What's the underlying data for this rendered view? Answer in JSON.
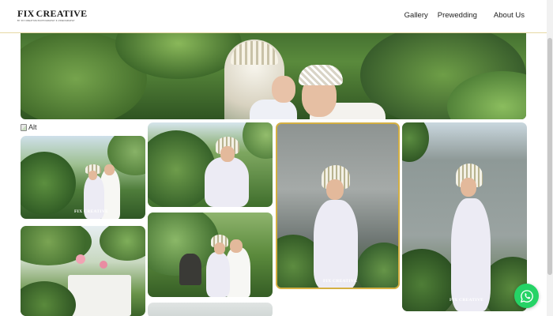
{
  "brand": {
    "logo_left": "FIX",
    "logo_right": "CREATIVE",
    "tagline": "BY FIX CREATIVE PHOTOGRAPHY & VIDEOGRAPHY"
  },
  "nav": {
    "items": [
      {
        "label": "Gallery"
      },
      {
        "label": "Prewedding"
      },
      {
        "label": "About Us"
      }
    ]
  },
  "gallery": {
    "broken_image_alt": "Alt",
    "watermark": "FIX CREATIVE"
  },
  "colors": {
    "accent_border": "#d4b043",
    "whatsapp": "#25d366",
    "header_divider": "#e6d9a4"
  },
  "icons": {
    "floating_button": "whatsapp-icon",
    "broken_image": "broken-image-icon"
  }
}
